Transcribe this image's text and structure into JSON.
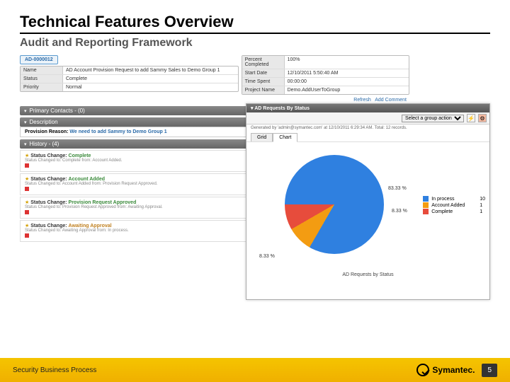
{
  "slide": {
    "title": "Technical Features Overview",
    "subtitle": "Audit and Reporting Framework"
  },
  "ticket": {
    "id": "AD-0000012",
    "fields_left": [
      {
        "label": "Name",
        "value": "AD Account Provision Request to add Sammy Sales to Demo Group 1"
      },
      {
        "label": "Status",
        "value": "Complete"
      },
      {
        "label": "Priority",
        "value": "Normal"
      }
    ],
    "fields_right": [
      {
        "label": "Percent Completed",
        "value": "100%"
      },
      {
        "label": "Start Date",
        "value": "12/10/2011 5:50:40 AM"
      },
      {
        "label": "Time Spent",
        "value": "00:00:00"
      },
      {
        "label": "Project Name",
        "value": "Demo.AddUserToGroup"
      }
    ],
    "links": {
      "refresh": "Refresh",
      "add_comment": "Add Comment"
    }
  },
  "sections": {
    "contacts": "Primary Contacts - (0)",
    "description": "Description",
    "history": "History - (4)"
  },
  "description": {
    "prefix": "Provision Reason:",
    "text": "We need to add Sammy to Demo Group 1"
  },
  "history": [
    {
      "title_prefix": "Status Change:",
      "title": "Complete",
      "cls": "hist-green",
      "body": "Status Changed to: Complete from: Account Added."
    },
    {
      "title_prefix": "Status Change:",
      "title": "Account Added",
      "cls": "hist-green",
      "body": "Status Changed to: Account Added from: Provision Request Approved."
    },
    {
      "title_prefix": "Status Change:",
      "title": "Provision Request Approved",
      "cls": "hist-green",
      "body": "Status Changed to: Provision Request Approved from: Awaiting Approval."
    },
    {
      "title_prefix": "Status Change:",
      "title": "Awaiting Approval",
      "cls": "hist-orange",
      "body": "Status Changed to: Awaiting Approval from: In process."
    }
  ],
  "chart": {
    "title": "AD Requests By Status",
    "action_label": "Select a group action",
    "meta": "Generated by 'admin@symantec.com' at 12/10/2011 6:29:34 AM. Total: 12 records.",
    "tabs": {
      "grid": "Grid",
      "chart": "Chart"
    },
    "caption": "AD Requests by Status"
  },
  "chart_data": {
    "type": "pie",
    "title": "AD Requests by Status",
    "series": [
      {
        "name": "In process",
        "value": 10,
        "pct": 83.33,
        "color": "#2f80e0"
      },
      {
        "name": "Account Added",
        "value": 1,
        "pct": 8.33,
        "color": "#f39c12"
      },
      {
        "name": "Complete",
        "value": 1,
        "pct": 8.33,
        "color": "#e74c3c"
      }
    ]
  },
  "footer": {
    "text": "Security Business Process",
    "brand": "Symantec.",
    "page": "5"
  }
}
